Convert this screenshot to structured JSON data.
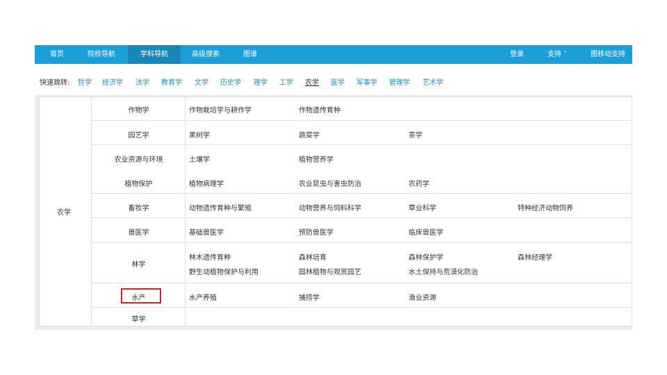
{
  "nav": {
    "items": [
      "首页",
      "院校导航",
      "学科导航",
      "高级搜索",
      "图谱"
    ],
    "login": "登录",
    "support": "支持",
    "mobile": "图移动支持"
  },
  "quick": {
    "label": "快速跳转:",
    "links": [
      "哲学",
      "经济学",
      "法学",
      "教育学",
      "文学",
      "历史学",
      "理学",
      "工学",
      "农学",
      "医学",
      "军事学",
      "管理学",
      "艺术学"
    ]
  },
  "table": {
    "category": "农学",
    "rows": [
      {
        "sub": "作物学",
        "majors": [
          "作物栽培学与耕作学",
          "作物遗传育种"
        ]
      },
      {
        "sub": "园艺学",
        "majors": [
          "果树学",
          "蔬菜学",
          "茶学"
        ]
      },
      {
        "sub": "农业资源与环境",
        "majors": [
          "土壤学",
          "植物营养学"
        ]
      },
      {
        "sub": "植物保护",
        "majors": [
          "植物病理学",
          "农业昆虫与害虫防治",
          "农药学"
        ]
      },
      {
        "sub": "畜牧学",
        "majors": [
          "动物遗传育种与繁殖",
          "动物营养与饲料科学",
          "草业科学",
          "特种经济动物饲养"
        ]
      },
      {
        "sub": "兽医学",
        "majors": [
          "基础兽医学",
          "预防兽医学",
          "临床兽医学"
        ]
      },
      {
        "sub": "林学",
        "majors": [
          "林木遗传育种",
          "森林培育",
          "森林保护学",
          "森林经理学",
          "野生动植物保护与利用",
          "园林植物与观赏园艺",
          "水土保持与荒漠化防治"
        ]
      },
      {
        "sub": "水产",
        "majors": [
          "水产养殖",
          "捕捞学",
          "渔业资源"
        ]
      },
      {
        "sub": "草学",
        "majors": []
      }
    ]
  },
  "colors": {
    "nav_bg": "#1a9fd9",
    "link": "#1a8fc8",
    "highlight": "#d9201f"
  }
}
